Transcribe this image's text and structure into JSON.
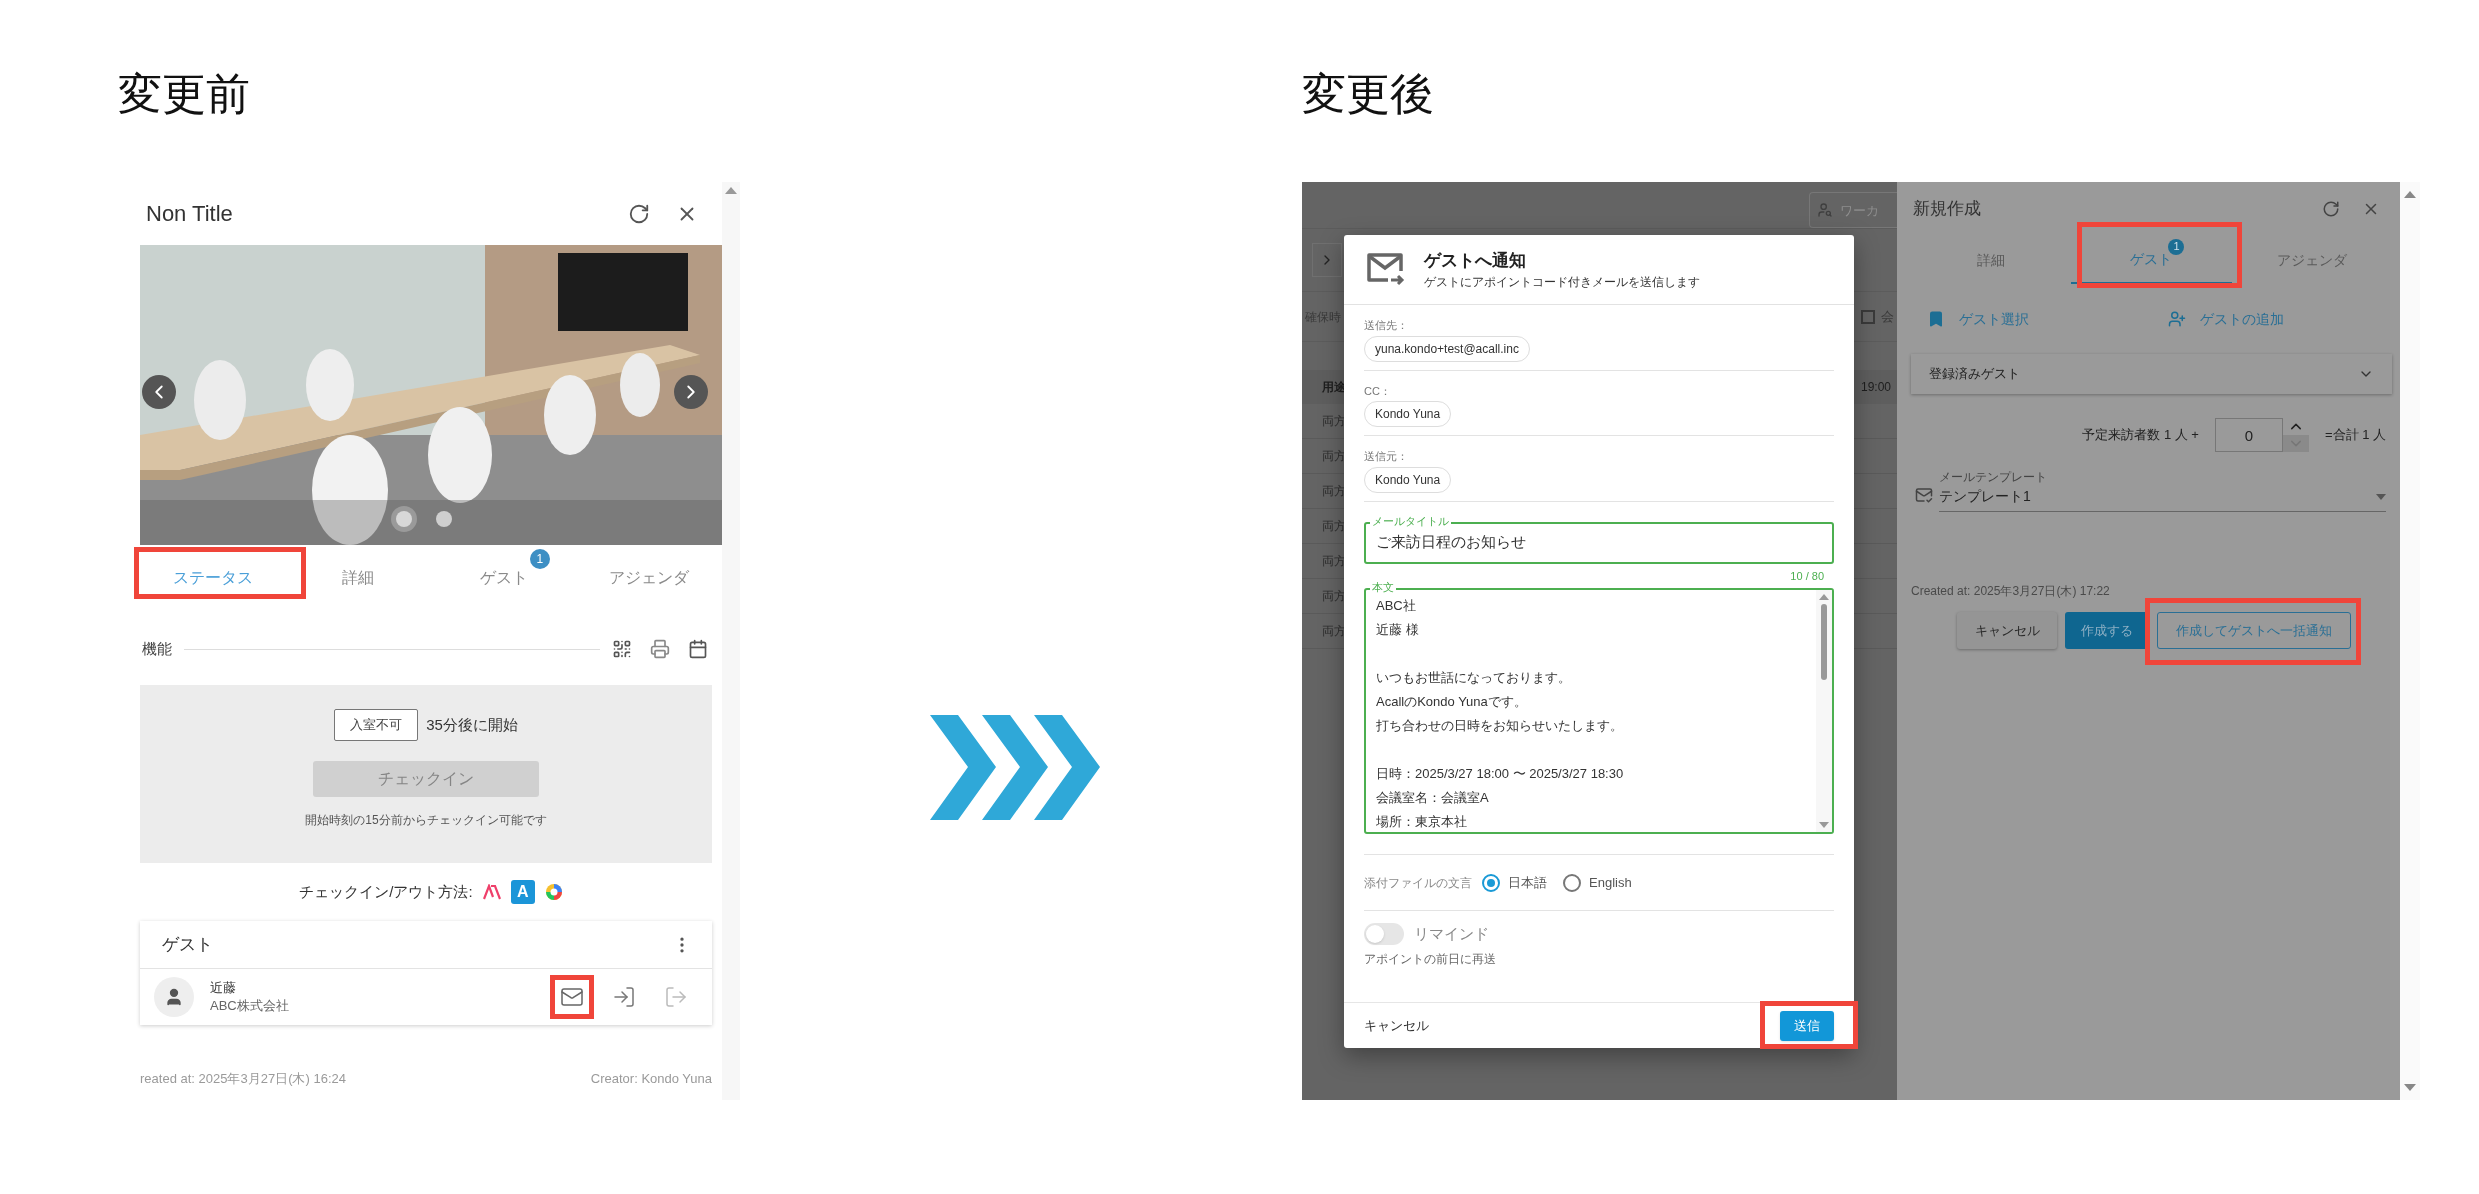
{
  "before": {
    "heading": "変更前",
    "panel": {
      "title": "Non Title",
      "carousel_dots": [
        {
          "selected": true
        },
        {
          "selected": false
        }
      ],
      "tabs": [
        {
          "label": "ステータス",
          "selected": true,
          "highlighted": true
        },
        {
          "label": "詳細",
          "selected": false,
          "highlighted": false
        },
        {
          "label": "ゲスト",
          "selected": false,
          "highlighted": false,
          "badge": "1"
        },
        {
          "label": "アジェンダ",
          "selected": false,
          "highlighted": false
        }
      ],
      "section_title": "機能",
      "status": {
        "badge": "入室不可",
        "message": "35分後に開始",
        "button": {
          "label": "チェックイン",
          "disabled": true
        },
        "note": "開始時刻の15分前からチェックイン可能です"
      },
      "methods": {
        "label": "チェックイン/アウト方法:",
        "items": [
          {
            "kind": "acall"
          },
          {
            "kind": "app",
            "text": "A"
          },
          {
            "kind": "wheel"
          }
        ]
      },
      "guest_card": {
        "title": "ゲスト",
        "guests": [
          {
            "name": "近藤",
            "company": "ABC株式会社",
            "mail_highlighted": true
          }
        ]
      },
      "created_at": "reated at: 2025年3月27日(木) 16:24",
      "creator": "Creator: Kondo Yuna"
    }
  },
  "after": {
    "heading": "変更後",
    "backdrop": {
      "search_placeholder": "ワーカ",
      "column_label": "確保時",
      "checkbox": {
        "label": "会",
        "checked": false
      },
      "table": {
        "header": "用途",
        "time": "19:00",
        "rows": [
          "両方",
          "両方",
          "両方",
          "両方",
          "両方",
          "両方",
          "両方"
        ]
      }
    },
    "dialog": {
      "title": "ゲストへ通知",
      "subtitle": "ゲストにアポイントコード付きメールを送信します",
      "recipients": [
        {
          "label": "送信先：",
          "chip": "yuna.kondo+test@acall.inc"
        },
        {
          "label": "CC：",
          "chip": "Kondo Yuna"
        },
        {
          "label": "送信元：",
          "chip": "Kondo Yuna"
        }
      ],
      "mail_title": {
        "label": "メールタイトル",
        "value": "ご来訪日程のお知らせ",
        "counter": "10 / 80"
      },
      "body": {
        "label": "本文",
        "paragraphs": [
          [
            "ABC社",
            "近藤 様"
          ],
          [
            "いつもお世話になっております。",
            "AcallのKondo Yunaです。",
            "打ち合わせの日時をお知らせいたします。"
          ],
          [
            "日時：2025/3/27 18:00 〜 2025/3/27 18:30",
            "会議室名：会議室A",
            "場所：東京本社"
          ]
        ]
      },
      "attachment": {
        "label": "添付ファイルの文言",
        "options": [
          {
            "label": "日本語",
            "selected": true
          },
          {
            "label": "English",
            "selected": false
          }
        ]
      },
      "remind": {
        "label": "リマインド",
        "on": false,
        "hint": "アポイントの前日に再送"
      },
      "cancel": "キャンセル",
      "send": {
        "label": "送信",
        "highlighted": true
      }
    },
    "side_panel": {
      "title": "新規作成",
      "tabs": [
        {
          "label": "詳細",
          "selected": false,
          "highlighted": false
        },
        {
          "label": "ゲスト",
          "selected": true,
          "highlighted": true,
          "badge": "1"
        },
        {
          "label": "アジェンダ",
          "selected": false,
          "highlighted": false
        }
      ],
      "actions": [
        {
          "kind": "select",
          "label": "ゲスト選択"
        },
        {
          "kind": "add",
          "label": "ゲストの追加"
        }
      ],
      "accordion": {
        "label": "登録済みゲスト",
        "expanded": false
      },
      "count": {
        "prefix": "予定来訪者数 1 人 +",
        "value": "0",
        "total": "=合計 1 人"
      },
      "template": {
        "label": "メールテンプレート",
        "value": "テンプレート1"
      },
      "created_at": "Created at: 2025年3月27日(木) 17:22",
      "buttons": [
        {
          "kind": "plain",
          "label": "キャンセル",
          "highlighted": false
        },
        {
          "kind": "primary",
          "label": "作成する",
          "highlighted": false
        },
        {
          "kind": "outline",
          "label": "作成してゲストへ一括通知",
          "highlighted": true
        }
      ]
    }
  }
}
